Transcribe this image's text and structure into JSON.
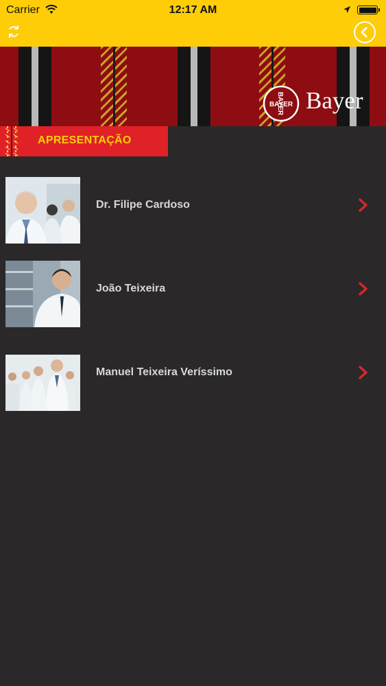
{
  "status_bar": {
    "carrier": "Carrier",
    "time": "12:17 AM"
  },
  "header": {
    "refresh_icon": "refresh-icon",
    "back_icon": "back-chevron-circle-icon",
    "accent_color": "#fecd08"
  },
  "banner": {
    "brand": "Bayer",
    "logo_text": "BAYER",
    "background_color": "#8e0d12"
  },
  "section": {
    "title": "APRESENTAÇÃO",
    "background_color": "#e02127"
  },
  "people": [
    {
      "name": "Dr. Filipe Cardoso"
    },
    {
      "name": "João Teixeira"
    },
    {
      "name": "Manuel Teixeira Veríssimo"
    }
  ]
}
